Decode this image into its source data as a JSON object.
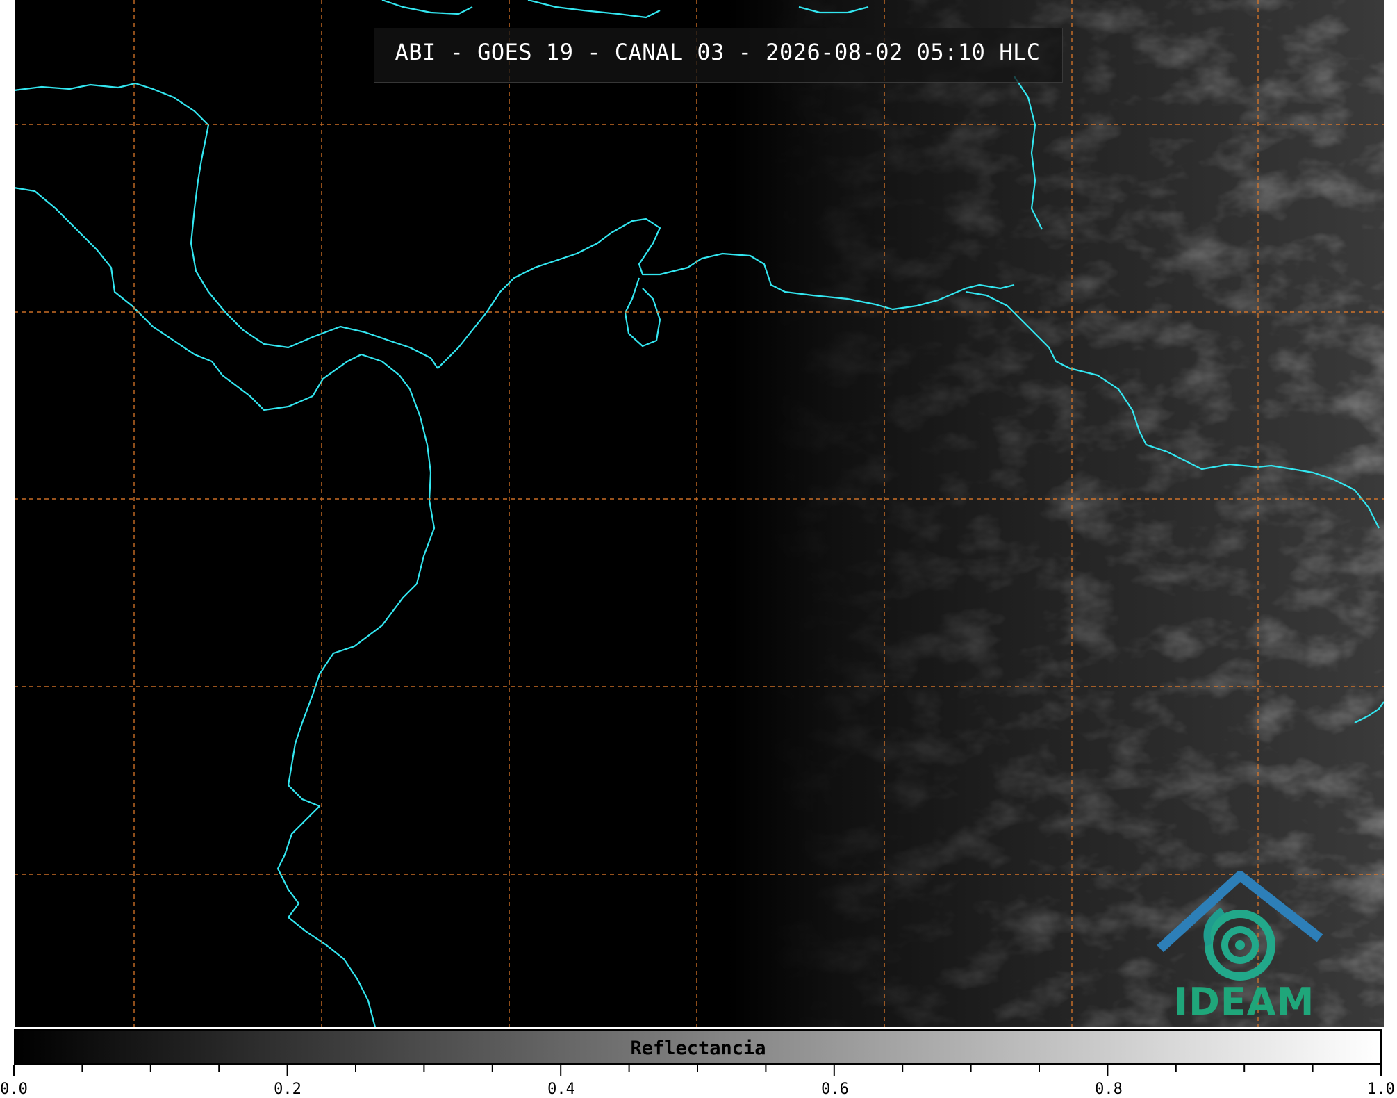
{
  "map": {
    "title": "ABI - GOES 19 - CANAL 03 - 2026-08-02 05:10 HLC",
    "satellite": "GOES 19",
    "instrument": "ABI",
    "channel": "03",
    "coastline_color": "#33e6f0",
    "grid_color": "#e07a2a"
  },
  "colorbar": {
    "label": "Reflectancia",
    "min": 0.0,
    "max": 1.0,
    "tick_labels": [
      "0.0",
      "0.2",
      "0.4",
      "0.6",
      "0.8",
      "1.0"
    ],
    "colormap": "gray"
  },
  "logo": {
    "text": "IDEAM",
    "color": "#1fa67a"
  }
}
